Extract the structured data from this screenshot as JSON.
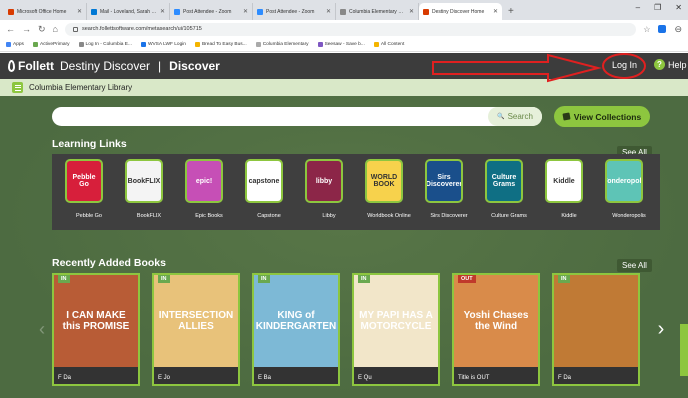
{
  "browser": {
    "tabs": [
      {
        "label": "Microsoft Office Home",
        "color": "#d83b01"
      },
      {
        "label": "Mail - Loveland, Sarah - Outlook",
        "color": "#0078d4"
      },
      {
        "label": "Post Attendee - Zoom",
        "color": "#2d8cff"
      },
      {
        "label": "Post Attendee - Zoom",
        "color": "#2d8cff"
      },
      {
        "label": "Columbia Elementary School",
        "color": "#888888"
      },
      {
        "label": "Destiny Discover Home",
        "color": "#d83b01"
      }
    ],
    "new_tab": "+",
    "url": "search.follettsoftware.com/metasearch/ui/105715",
    "window_controls": [
      "–",
      "❐",
      "✕"
    ],
    "bookmarks": [
      {
        "label": "Apps",
        "color": "#4285f4"
      },
      {
        "label": "ActivePrimary",
        "color": "#6aa84f"
      },
      {
        "label": "Log In - Columbia E...",
        "color": "#888888"
      },
      {
        "label": "WVSA LWF Login",
        "color": "#1a73e8"
      },
      {
        "label": "Bread To Easy Bus...",
        "color": "#f4b400"
      },
      {
        "label": "Columbia Elementary",
        "color": "#aaaaaa"
      },
      {
        "label": "Seesaw - Save b...",
        "color": "#7e57c2"
      },
      {
        "label": "All Content",
        "color": "#f4b400"
      }
    ]
  },
  "header": {
    "brand": "Follett",
    "product": "Destiny Discover",
    "separator": "|",
    "page": "Discover",
    "login_label": "Log In",
    "help_label": "Help",
    "help_icon": "?"
  },
  "library": {
    "name": "Columbia Elementary Library"
  },
  "search": {
    "placeholder": "",
    "button_label": "Search",
    "button_icon": "🔍"
  },
  "view_collections_label": "View Collections",
  "learning_links": {
    "title": "Learning Links",
    "see_all": "See All",
    "items": [
      {
        "name": "Pebble Go",
        "art": "Pebble Go",
        "bg": "#d71f3b"
      },
      {
        "name": "BookFLIX",
        "art": "BookFLIX",
        "bg": "#f4f4f4"
      },
      {
        "name": "Epic Books",
        "art": "epic!",
        "bg": "#c64fb6"
      },
      {
        "name": "Capstone",
        "art": "capstone",
        "bg": "#ffffff"
      },
      {
        "name": "Libby",
        "art": "libby",
        "bg": "#8c2648"
      },
      {
        "name": "Worldbook Online",
        "art": "WORLD BOOK",
        "bg": "#f7d24c"
      },
      {
        "name": "Sirs Discoverer",
        "art": "Sirs Discoverer",
        "bg": "#1a4f8b"
      },
      {
        "name": "Culture Grams",
        "art": "Culture Grams",
        "bg": "#0f6f84"
      },
      {
        "name": "Kiddle",
        "art": "Kiddle",
        "bg": "#ffffff"
      },
      {
        "name": "Wonderopolis",
        "art": "Wonderopolis",
        "bg": "#5ec4b6"
      }
    ]
  },
  "recent_books": {
    "title": "Recently Added Books",
    "see_all": "See All",
    "items": [
      {
        "status": "IN",
        "cover_text": "I CAN MAKE this PROMISE",
        "call_no": "F Da",
        "bg": "#b85c36"
      },
      {
        "status": "IN",
        "cover_text": "INTERSECTION ALLIES",
        "call_no": "E Jo",
        "bg": "#e8c27a"
      },
      {
        "status": "IN",
        "cover_text": "KING of KINDERGARTEN",
        "call_no": "E Ba",
        "bg": "#7db9d6"
      },
      {
        "status": "IN",
        "cover_text": "MY PAPI HAS A MOTORCYCLE",
        "call_no": "E Qu",
        "bg": "#f2e6c9"
      },
      {
        "status": "OUT",
        "cover_text": "Yoshi Chases the Wind",
        "call_no": "Title is OUT",
        "bg": "#d98b4a"
      },
      {
        "status": "IN",
        "cover_text": "",
        "call_no": "F Da",
        "bg": "#c07a35"
      }
    ]
  },
  "colors": {
    "accent": "#8dc63f",
    "header": "#3c3c3c",
    "annotation": "#e02020"
  }
}
